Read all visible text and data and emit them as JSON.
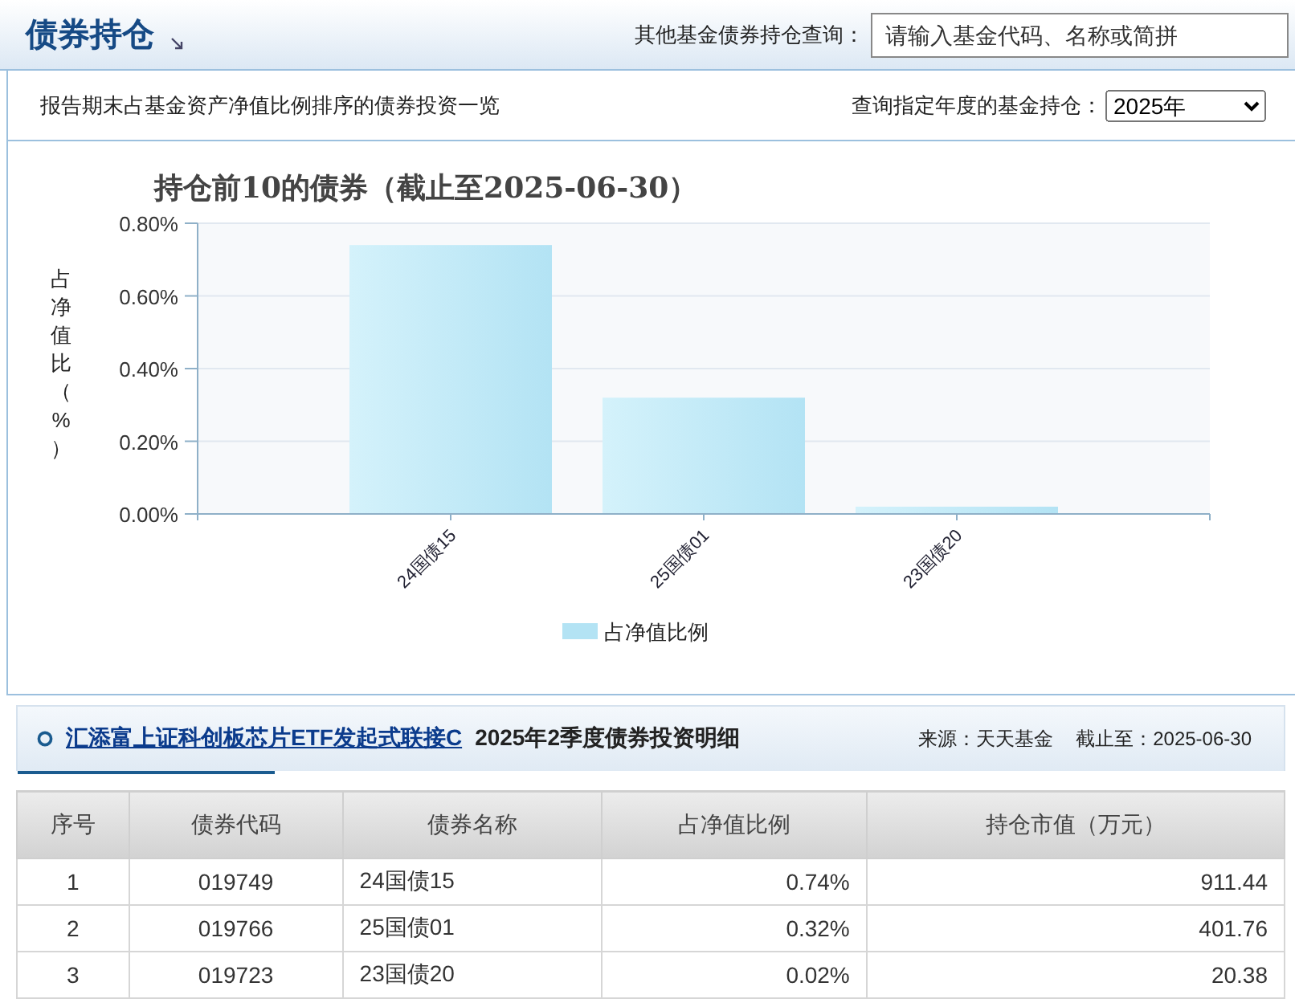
{
  "header": {
    "title": "债券持仓",
    "search": {
      "label": "其他基金债券持仓查询：",
      "placeholder": "请输入基金代码、名称或简拼"
    }
  },
  "subheader": {
    "description": "报告期末占基金资产净值比例排序的债券投资一览",
    "year_label": "查询指定年度的基金持仓：",
    "year_select": "2025年"
  },
  "chart_data": {
    "type": "bar",
    "title": "持仓前10的债券（截止至2025-06-30）",
    "ylabel": "占净值比（%）",
    "categories": [
      "24国债15",
      "25国债01",
      "23国债20"
    ],
    "series": [
      {
        "name": "占净值比例",
        "color": "#b3e3f4",
        "values": [
          0.74,
          0.32,
          0.02
        ]
      }
    ],
    "ylim": [
      0,
      0.8
    ],
    "grid": true,
    "yticks": [
      {
        "value": 0,
        "label": "0.00%"
      },
      {
        "value": 0.2,
        "label": "0.20%"
      },
      {
        "value": 0.4,
        "label": "0.40%"
      },
      {
        "value": 0.6,
        "label": "0.60%"
      },
      {
        "value": 0.8,
        "label": "0.80%"
      }
    ]
  },
  "detail": {
    "fund_link": "汇添富上证科创板芯片ETF发起式联接C",
    "title": "2025年2季度债券投资明细",
    "source": "来源：天天基金",
    "as_of": "截止至：2025-06-30",
    "columns": [
      "序号",
      "债券代码",
      "债券名称",
      "占净值比例",
      "持仓市值（万元）"
    ],
    "rows": [
      [
        "1",
        "019749",
        "24国债15",
        "0.74%",
        "911.44"
      ],
      [
        "2",
        "019766",
        "25国债01",
        "0.32%",
        "401.76"
      ],
      [
        "3",
        "019723",
        "23国债20",
        "0.02%",
        "20.38"
      ]
    ]
  }
}
